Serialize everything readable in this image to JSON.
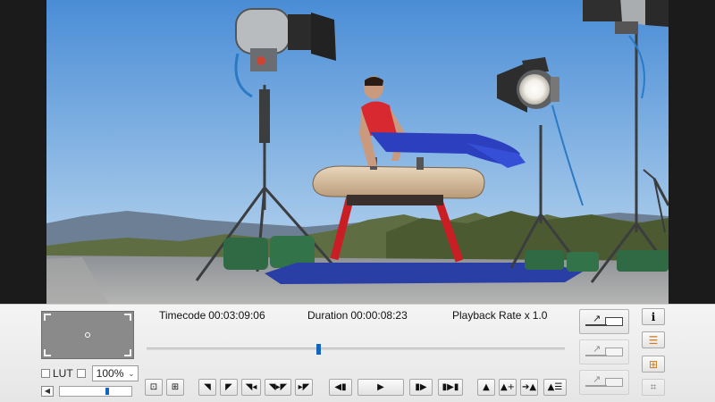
{
  "player": {
    "timecode_label": "Timecode",
    "timecode_value": "00:03:09:06",
    "duration_label": "Duration",
    "duration_value": "00:00:08:23",
    "playback_rate_label": "Playback Rate x",
    "playback_rate_value": "1.0",
    "scrub_progress": 0.41
  },
  "view": {
    "lut_label": "LUT",
    "lut_checked": false,
    "extra_checked": false,
    "zoom_value": "100%",
    "volume_level": 0.66
  },
  "colors": {
    "accent": "#1565c0",
    "panel_bg": "#eeeeee",
    "letterbox": "#1b1b1b"
  },
  "transport": [
    {
      "name": "mark-in-button",
      "icon": "mark-in-icon",
      "glyph": "◥"
    },
    {
      "name": "mark-out-button",
      "icon": "mark-out-icon",
      "glyph": "◤"
    },
    {
      "name": "go-to-in-button",
      "icon": "go-to-in-icon",
      "glyph": "◥◂"
    },
    {
      "name": "play-in-out-button",
      "icon": "play-in-out-icon",
      "glyph": "◥▸◤"
    },
    {
      "name": "go-to-out-button",
      "icon": "go-to-out-icon",
      "glyph": "▸◤"
    },
    {
      "name": "step-back-button",
      "icon": "step-back-icon",
      "glyph": "◀▮"
    },
    {
      "name": "play-button",
      "icon": "play-icon",
      "glyph": "▶"
    },
    {
      "name": "step-forward-button",
      "icon": "step-forward-icon",
      "glyph": "▮▶"
    },
    {
      "name": "skip-end-button",
      "icon": "skip-end-icon",
      "glyph": "▮▶▮"
    },
    {
      "name": "add-marker-button",
      "icon": "marker-icon",
      "glyph": "▲"
    },
    {
      "name": "add-marker-plus-button",
      "icon": "marker-add-icon",
      "glyph": "▲+"
    },
    {
      "name": "go-marker-button",
      "icon": "marker-goto-icon",
      "glyph": "➔▲"
    },
    {
      "name": "marker-list-button",
      "icon": "marker-list-icon",
      "glyph": "▲☰"
    }
  ],
  "snapshot_icons": [
    {
      "name": "snapshot-button",
      "icon": "camera-icon",
      "glyph": "⊡"
    },
    {
      "name": "snapshot-save-button",
      "icon": "camera-save-icon",
      "glyph": "⊞"
    }
  ],
  "right_tools": [
    {
      "name": "info-button",
      "icon": "info-icon",
      "glyph": "i"
    },
    {
      "name": "list-view-button",
      "icon": "list-icon",
      "glyph": "☰"
    },
    {
      "name": "clip-split-button",
      "icon": "split-icon",
      "glyph": "⊞"
    },
    {
      "name": "overlay-button",
      "icon": "overlay-icon",
      "glyph": "⌗"
    }
  ]
}
